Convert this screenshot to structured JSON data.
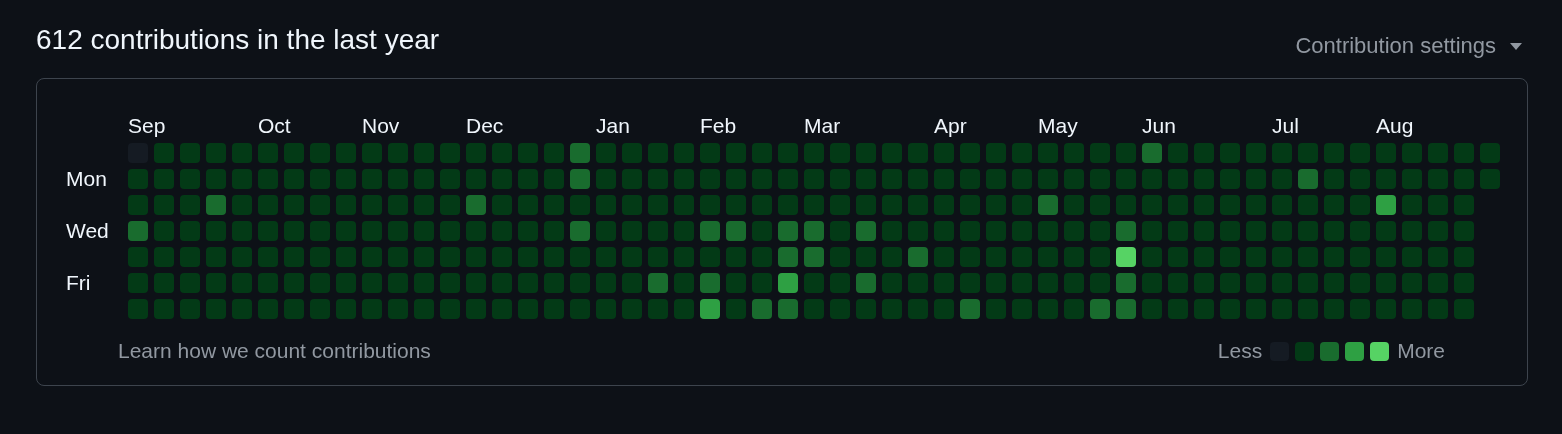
{
  "title": "612 contributions in the last year",
  "settings": {
    "label": "Contribution settings"
  },
  "day_labels": [
    "Mon",
    "Wed",
    "Fri"
  ],
  "weeks": [
    {
      "month": "Sep",
      "days": [
        {
          "color": "#151b23"
        },
        {
          "color": "#033a16"
        },
        {
          "color": "#033a16"
        },
        {
          "color": "#196c2e"
        },
        {
          "color": "#033a16"
        },
        {
          "color": "#033a16"
        },
        {
          "color": "#033a16"
        }
      ]
    },
    {
      "days": [
        {
          "color": "#033a16"
        },
        {
          "color": "#033a16"
        },
        {
          "color": "#033a16"
        },
        {
          "color": "#033a16"
        },
        {
          "color": "#033a16"
        },
        {
          "color": "#033a16"
        },
        {
          "color": "#033a16"
        }
      ]
    },
    {
      "days": [
        {
          "color": "#033a16"
        },
        {
          "color": "#033a16"
        },
        {
          "color": "#033a16"
        },
        {
          "color": "#033a16"
        },
        {
          "color": "#033a16"
        },
        {
          "color": "#033a16"
        },
        {
          "color": "#033a16"
        }
      ]
    },
    {
      "days": [
        {
          "color": "#033a16"
        },
        {
          "color": "#033a16"
        },
        {
          "color": "#196c2e"
        },
        {
          "color": "#033a16"
        },
        {
          "color": "#033a16"
        },
        {
          "color": "#033a16"
        },
        {
          "color": "#033a16"
        }
      ]
    },
    {
      "days": [
        {
          "color": "#033a16"
        },
        {
          "color": "#033a16"
        },
        {
          "color": "#033a16"
        },
        {
          "color": "#033a16"
        },
        {
          "color": "#033a16"
        },
        {
          "color": "#033a16"
        },
        {
          "color": "#033a16"
        }
      ]
    },
    {
      "month": "Oct",
      "days": [
        {
          "color": "#033a16"
        },
        {
          "color": "#033a16"
        },
        {
          "color": "#033a16"
        },
        {
          "color": "#033a16"
        },
        {
          "color": "#033a16"
        },
        {
          "color": "#033a16"
        },
        {
          "color": "#033a16"
        }
      ]
    },
    {
      "days": [
        {
          "color": "#033a16"
        },
        {
          "color": "#033a16"
        },
        {
          "color": "#033a16"
        },
        {
          "color": "#033a16"
        },
        {
          "color": "#033a16"
        },
        {
          "color": "#033a16"
        },
        {
          "color": "#033a16"
        }
      ]
    },
    {
      "days": [
        {
          "color": "#033a16"
        },
        {
          "color": "#033a16"
        },
        {
          "color": "#033a16"
        },
        {
          "color": "#033a16"
        },
        {
          "color": "#033a16"
        },
        {
          "color": "#033a16"
        },
        {
          "color": "#033a16"
        }
      ]
    },
    {
      "days": [
        {
          "color": "#033a16"
        },
        {
          "color": "#033a16"
        },
        {
          "color": "#033a16"
        },
        {
          "color": "#033a16"
        },
        {
          "color": "#033a16"
        },
        {
          "color": "#033a16"
        },
        {
          "color": "#033a16"
        }
      ]
    },
    {
      "month": "Nov",
      "days": [
        {
          "color": "#033a16"
        },
        {
          "color": "#033a16"
        },
        {
          "color": "#033a16"
        },
        {
          "color": "#033a16"
        },
        {
          "color": "#033a16"
        },
        {
          "color": "#033a16"
        },
        {
          "color": "#033a16"
        }
      ]
    },
    {
      "days": [
        {
          "color": "#033a16"
        },
        {
          "color": "#033a16"
        },
        {
          "color": "#033a16"
        },
        {
          "color": "#033a16"
        },
        {
          "color": "#033a16"
        },
        {
          "color": "#033a16"
        },
        {
          "color": "#033a16"
        }
      ]
    },
    {
      "days": [
        {
          "color": "#033a16"
        },
        {
          "color": "#033a16"
        },
        {
          "color": "#033a16"
        },
        {
          "color": "#033a16"
        },
        {
          "color": "#033a16"
        },
        {
          "color": "#033a16"
        },
        {
          "color": "#033a16"
        }
      ]
    },
    {
      "days": [
        {
          "color": "#033a16"
        },
        {
          "color": "#033a16"
        },
        {
          "color": "#033a16"
        },
        {
          "color": "#033a16"
        },
        {
          "color": "#033a16"
        },
        {
          "color": "#033a16"
        },
        {
          "color": "#033a16"
        }
      ]
    },
    {
      "month": "Dec",
      "days": [
        {
          "color": "#033a16"
        },
        {
          "color": "#033a16"
        },
        {
          "color": "#196c2e"
        },
        {
          "color": "#033a16"
        },
        {
          "color": "#033a16"
        },
        {
          "color": "#033a16"
        },
        {
          "color": "#033a16"
        }
      ]
    },
    {
      "days": [
        {
          "color": "#033a16"
        },
        {
          "color": "#033a16"
        },
        {
          "color": "#033a16"
        },
        {
          "color": "#033a16"
        },
        {
          "color": "#033a16"
        },
        {
          "color": "#033a16"
        },
        {
          "color": "#033a16"
        }
      ]
    },
    {
      "days": [
        {
          "color": "#033a16"
        },
        {
          "color": "#033a16"
        },
        {
          "color": "#033a16"
        },
        {
          "color": "#033a16"
        },
        {
          "color": "#033a16"
        },
        {
          "color": "#033a16"
        },
        {
          "color": "#033a16"
        }
      ]
    },
    {
      "days": [
        {
          "color": "#033a16"
        },
        {
          "color": "#033a16"
        },
        {
          "color": "#033a16"
        },
        {
          "color": "#033a16"
        },
        {
          "color": "#033a16"
        },
        {
          "color": "#033a16"
        },
        {
          "color": "#033a16"
        }
      ]
    },
    {
      "days": [
        {
          "color": "#196c2e"
        },
        {
          "color": "#196c2e"
        },
        {
          "color": "#033a16"
        },
        {
          "color": "#196c2e"
        },
        {
          "color": "#033a16"
        },
        {
          "color": "#033a16"
        },
        {
          "color": "#033a16"
        }
      ]
    },
    {
      "month": "Jan",
      "days": [
        {
          "color": "#033a16"
        },
        {
          "color": "#033a16"
        },
        {
          "color": "#033a16"
        },
        {
          "color": "#033a16"
        },
        {
          "color": "#033a16"
        },
        {
          "color": "#033a16"
        },
        {
          "color": "#033a16"
        }
      ]
    },
    {
      "days": [
        {
          "color": "#033a16"
        },
        {
          "color": "#033a16"
        },
        {
          "color": "#033a16"
        },
        {
          "color": "#033a16"
        },
        {
          "color": "#033a16"
        },
        {
          "color": "#033a16"
        },
        {
          "color": "#033a16"
        }
      ]
    },
    {
      "days": [
        {
          "color": "#033a16"
        },
        {
          "color": "#033a16"
        },
        {
          "color": "#033a16"
        },
        {
          "color": "#033a16"
        },
        {
          "color": "#033a16"
        },
        {
          "color": "#196c2e"
        },
        {
          "color": "#033a16"
        }
      ]
    },
    {
      "days": [
        {
          "color": "#033a16"
        },
        {
          "color": "#033a16"
        },
        {
          "color": "#033a16"
        },
        {
          "color": "#033a16"
        },
        {
          "color": "#033a16"
        },
        {
          "color": "#033a16"
        },
        {
          "color": "#033a16"
        }
      ]
    },
    {
      "month": "Feb",
      "days": [
        {
          "color": "#033a16"
        },
        {
          "color": "#033a16"
        },
        {
          "color": "#033a16"
        },
        {
          "color": "#196c2e"
        },
        {
          "color": "#033a16"
        },
        {
          "color": "#196c2e"
        },
        {
          "color": "#2ea043"
        }
      ]
    },
    {
      "days": [
        {
          "color": "#033a16"
        },
        {
          "color": "#033a16"
        },
        {
          "color": "#033a16"
        },
        {
          "color": "#196c2e"
        },
        {
          "color": "#033a16"
        },
        {
          "color": "#033a16"
        },
        {
          "color": "#033a16"
        }
      ]
    },
    {
      "days": [
        {
          "color": "#033a16"
        },
        {
          "color": "#033a16"
        },
        {
          "color": "#033a16"
        },
        {
          "color": "#033a16"
        },
        {
          "color": "#033a16"
        },
        {
          "color": "#033a16"
        },
        {
          "color": "#196c2e"
        }
      ]
    },
    {
      "days": [
        {
          "color": "#033a16"
        },
        {
          "color": "#033a16"
        },
        {
          "color": "#033a16"
        },
        {
          "color": "#196c2e"
        },
        {
          "color": "#196c2e"
        },
        {
          "color": "#2ea043"
        },
        {
          "color": "#196c2e"
        }
      ]
    },
    {
      "month": "Mar",
      "days": [
        {
          "color": "#033a16"
        },
        {
          "color": "#033a16"
        },
        {
          "color": "#033a16"
        },
        {
          "color": "#196c2e"
        },
        {
          "color": "#196c2e"
        },
        {
          "color": "#033a16"
        },
        {
          "color": "#033a16"
        }
      ]
    },
    {
      "days": [
        {
          "color": "#033a16"
        },
        {
          "color": "#033a16"
        },
        {
          "color": "#033a16"
        },
        {
          "color": "#033a16"
        },
        {
          "color": "#033a16"
        },
        {
          "color": "#033a16"
        },
        {
          "color": "#033a16"
        }
      ]
    },
    {
      "days": [
        {
          "color": "#033a16"
        },
        {
          "color": "#033a16"
        },
        {
          "color": "#033a16"
        },
        {
          "color": "#196c2e"
        },
        {
          "color": "#033a16"
        },
        {
          "color": "#196c2e"
        },
        {
          "color": "#033a16"
        }
      ]
    },
    {
      "days": [
        {
          "color": "#033a16"
        },
        {
          "color": "#033a16"
        },
        {
          "color": "#033a16"
        },
        {
          "color": "#033a16"
        },
        {
          "color": "#033a16"
        },
        {
          "color": "#033a16"
        },
        {
          "color": "#033a16"
        }
      ]
    },
    {
      "days": [
        {
          "color": "#033a16"
        },
        {
          "color": "#033a16"
        },
        {
          "color": "#033a16"
        },
        {
          "color": "#033a16"
        },
        {
          "color": "#196c2e"
        },
        {
          "color": "#033a16"
        },
        {
          "color": "#033a16"
        }
      ]
    },
    {
      "month": "Apr",
      "days": [
        {
          "color": "#033a16"
        },
        {
          "color": "#033a16"
        },
        {
          "color": "#033a16"
        },
        {
          "color": "#033a16"
        },
        {
          "color": "#033a16"
        },
        {
          "color": "#033a16"
        },
        {
          "color": "#033a16"
        }
      ]
    },
    {
      "days": [
        {
          "color": "#033a16"
        },
        {
          "color": "#033a16"
        },
        {
          "color": "#033a16"
        },
        {
          "color": "#033a16"
        },
        {
          "color": "#033a16"
        },
        {
          "color": "#033a16"
        },
        {
          "color": "#196c2e"
        }
      ]
    },
    {
      "days": [
        {
          "color": "#033a16"
        },
        {
          "color": "#033a16"
        },
        {
          "color": "#033a16"
        },
        {
          "color": "#033a16"
        },
        {
          "color": "#033a16"
        },
        {
          "color": "#033a16"
        },
        {
          "color": "#033a16"
        }
      ]
    },
    {
      "days": [
        {
          "color": "#033a16"
        },
        {
          "color": "#033a16"
        },
        {
          "color": "#033a16"
        },
        {
          "color": "#033a16"
        },
        {
          "color": "#033a16"
        },
        {
          "color": "#033a16"
        },
        {
          "color": "#033a16"
        }
      ]
    },
    {
      "month": "May",
      "days": [
        {
          "color": "#033a16"
        },
        {
          "color": "#033a16"
        },
        {
          "color": "#196c2e"
        },
        {
          "color": "#033a16"
        },
        {
          "color": "#033a16"
        },
        {
          "color": "#033a16"
        },
        {
          "color": "#033a16"
        }
      ]
    },
    {
      "days": [
        {
          "color": "#033a16"
        },
        {
          "color": "#033a16"
        },
        {
          "color": "#033a16"
        },
        {
          "color": "#033a16"
        },
        {
          "color": "#033a16"
        },
        {
          "color": "#033a16"
        },
        {
          "color": "#033a16"
        }
      ]
    },
    {
      "days": [
        {
          "color": "#033a16"
        },
        {
          "color": "#033a16"
        },
        {
          "color": "#033a16"
        },
        {
          "color": "#033a16"
        },
        {
          "color": "#033a16"
        },
        {
          "color": "#033a16"
        },
        {
          "color": "#196c2e"
        }
      ]
    },
    {
      "days": [
        {
          "color": "#033a16"
        },
        {
          "color": "#033a16"
        },
        {
          "color": "#033a16"
        },
        {
          "color": "#196c2e"
        },
        {
          "color": "#56d364"
        },
        {
          "color": "#196c2e"
        },
        {
          "color": "#196c2e"
        }
      ]
    },
    {
      "month": "Jun",
      "days": [
        {
          "color": "#196c2e"
        },
        {
          "color": "#033a16"
        },
        {
          "color": "#033a16"
        },
        {
          "color": "#033a16"
        },
        {
          "color": "#033a16"
        },
        {
          "color": "#033a16"
        },
        {
          "color": "#033a16"
        }
      ]
    },
    {
      "days": [
        {
          "color": "#033a16"
        },
        {
          "color": "#033a16"
        },
        {
          "color": "#033a16"
        },
        {
          "color": "#033a16"
        },
        {
          "color": "#033a16"
        },
        {
          "color": "#033a16"
        },
        {
          "color": "#033a16"
        }
      ]
    },
    {
      "days": [
        {
          "color": "#033a16"
        },
        {
          "color": "#033a16"
        },
        {
          "color": "#033a16"
        },
        {
          "color": "#033a16"
        },
        {
          "color": "#033a16"
        },
        {
          "color": "#033a16"
        },
        {
          "color": "#033a16"
        }
      ]
    },
    {
      "days": [
        {
          "color": "#033a16"
        },
        {
          "color": "#033a16"
        },
        {
          "color": "#033a16"
        },
        {
          "color": "#033a16"
        },
        {
          "color": "#033a16"
        },
        {
          "color": "#033a16"
        },
        {
          "color": "#033a16"
        }
      ]
    },
    {
      "days": [
        {
          "color": "#033a16"
        },
        {
          "color": "#033a16"
        },
        {
          "color": "#033a16"
        },
        {
          "color": "#033a16"
        },
        {
          "color": "#033a16"
        },
        {
          "color": "#033a16"
        },
        {
          "color": "#033a16"
        }
      ]
    },
    {
      "month": "Jul",
      "days": [
        {
          "color": "#033a16"
        },
        {
          "color": "#033a16"
        },
        {
          "color": "#033a16"
        },
        {
          "color": "#033a16"
        },
        {
          "color": "#033a16"
        },
        {
          "color": "#033a16"
        },
        {
          "color": "#033a16"
        }
      ]
    },
    {
      "days": [
        {
          "color": "#033a16"
        },
        {
          "color": "#196c2e"
        },
        {
          "color": "#033a16"
        },
        {
          "color": "#033a16"
        },
        {
          "color": "#033a16"
        },
        {
          "color": "#033a16"
        },
        {
          "color": "#033a16"
        }
      ]
    },
    {
      "days": [
        {
          "color": "#033a16"
        },
        {
          "color": "#033a16"
        },
        {
          "color": "#033a16"
        },
        {
          "color": "#033a16"
        },
        {
          "color": "#033a16"
        },
        {
          "color": "#033a16"
        },
        {
          "color": "#033a16"
        }
      ]
    },
    {
      "days": [
        {
          "color": "#033a16"
        },
        {
          "color": "#033a16"
        },
        {
          "color": "#033a16"
        },
        {
          "color": "#033a16"
        },
        {
          "color": "#033a16"
        },
        {
          "color": "#033a16"
        },
        {
          "color": "#033a16"
        }
      ]
    },
    {
      "month": "Aug",
      "days": [
        {
          "color": "#033a16"
        },
        {
          "color": "#033a16"
        },
        {
          "color": "#2ea043"
        },
        {
          "color": "#033a16"
        },
        {
          "color": "#033a16"
        },
        {
          "color": "#033a16"
        },
        {
          "color": "#033a16"
        }
      ]
    },
    {
      "days": [
        {
          "color": "#033a16"
        },
        {
          "color": "#033a16"
        },
        {
          "color": "#033a16"
        },
        {
          "color": "#033a16"
        },
        {
          "color": "#033a16"
        },
        {
          "color": "#033a16"
        },
        {
          "color": "#033a16"
        }
      ]
    },
    {
      "days": [
        {
          "color": "#033a16"
        },
        {
          "color": "#033a16"
        },
        {
          "color": "#033a16"
        },
        {
          "color": "#033a16"
        },
        {
          "color": "#033a16"
        },
        {
          "color": "#033a16"
        },
        {
          "color": "#033a16"
        }
      ]
    },
    {
      "days": [
        {
          "color": "#033a16"
        },
        {
          "color": "#033a16"
        },
        {
          "color": "#033a16"
        },
        {
          "color": "#033a16"
        },
        {
          "color": "#033a16"
        },
        {
          "color": "#033a16"
        },
        {
          "color": "#033a16"
        }
      ]
    },
    {
      "days": [
        {
          "color": "#033a16"
        },
        {
          "color": "#033a16"
        }
      ]
    }
  ],
  "footer": {
    "link": "Learn how we count contributions",
    "less": "Less",
    "more": "More",
    "legend": [
      {
        "color": "#151b23"
      },
      {
        "color": "#033a16"
      },
      {
        "color": "#196c2e"
      },
      {
        "color": "#2ea043"
      },
      {
        "color": "#56d364"
      }
    ]
  }
}
